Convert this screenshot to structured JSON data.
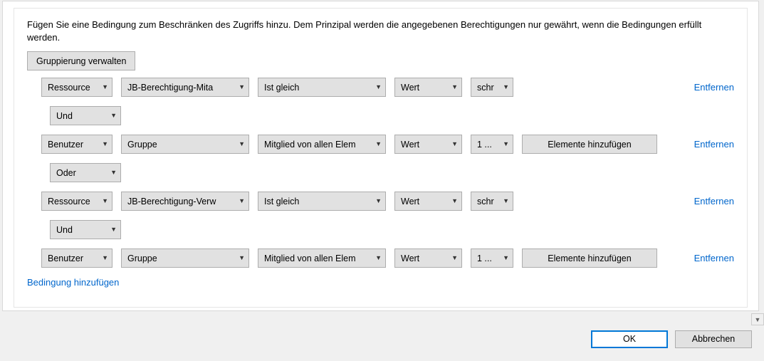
{
  "description": "Fügen Sie eine Bedingung zum Beschränken des Zugriffs hinzu. Dem Prinzipal werden die angegebenen Berechtigungen nur gewährt, wenn die Bedingungen erfüllt werden.",
  "manageGroupingLabel": "Gruppierung verwalten",
  "removeLabel": "Entfernen",
  "addElementsLabel": "Elemente hinzufügen",
  "addConditionLabel": "Bedingung hinzufügen",
  "okLabel": "OK",
  "cancelLabel": "Abbrechen",
  "rows": [
    {
      "type": "Ressource",
      "attr": "JB-Berechtigung-Mita",
      "op": "Ist gleich",
      "valType": "Wert",
      "val": "schr",
      "hasAddBtn": false
    },
    {
      "logic": "Und"
    },
    {
      "type": "Benutzer",
      "attr": "Gruppe",
      "op": "Mitglied von allen Elem",
      "valType": "Wert",
      "val": "1 ...",
      "hasAddBtn": true
    },
    {
      "logic": "Oder"
    },
    {
      "type": "Ressource",
      "attr": "JB-Berechtigung-Verw",
      "op": "Ist gleich",
      "valType": "Wert",
      "val": "schr",
      "hasAddBtn": false
    },
    {
      "logic": "Und"
    },
    {
      "type": "Benutzer",
      "attr": "Gruppe",
      "op": "Mitglied von allen Elem",
      "valType": "Wert",
      "val": "1 ...",
      "hasAddBtn": true
    }
  ]
}
